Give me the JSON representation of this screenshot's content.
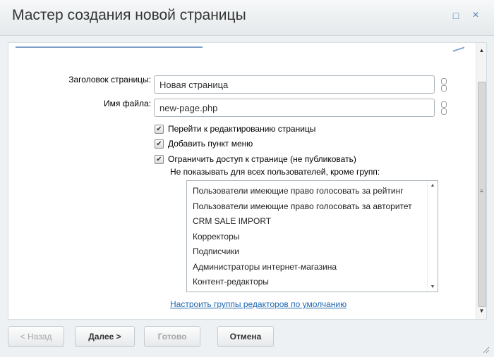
{
  "window": {
    "title": "Мастер создания новой страницы",
    "maximize_glyph": "□",
    "close_glyph": "×"
  },
  "form": {
    "page_title_label": "Заголовок страницы:",
    "page_title_value": "Новая страница",
    "file_name_label": "Имя файла:",
    "file_name_value": "new-page.php",
    "checkboxes": [
      {
        "label": "Перейти к редактированию страницы",
        "checked": true
      },
      {
        "label": "Добавить пункт меню",
        "checked": true
      },
      {
        "label": "Ограничить доступ к странице (не публиковать)",
        "checked": true
      }
    ],
    "groups_label": "Не показывать для всех пользователей, кроме групп:",
    "groups": [
      "Пользователи имеющие право голосовать за рейтинг",
      "Пользователи имеющие право голосовать за авторитет",
      "CRM SALE IMPORT",
      "Корректоры",
      "Подписчики",
      "Администраторы интернет-магазина",
      "Контент-редакторы"
    ],
    "configure_link": "Настроить группы редакторов по умолчанию"
  },
  "buttons": {
    "back": "< Назад",
    "next": "Далее >",
    "done": "Готово",
    "cancel": "Отмена"
  }
}
